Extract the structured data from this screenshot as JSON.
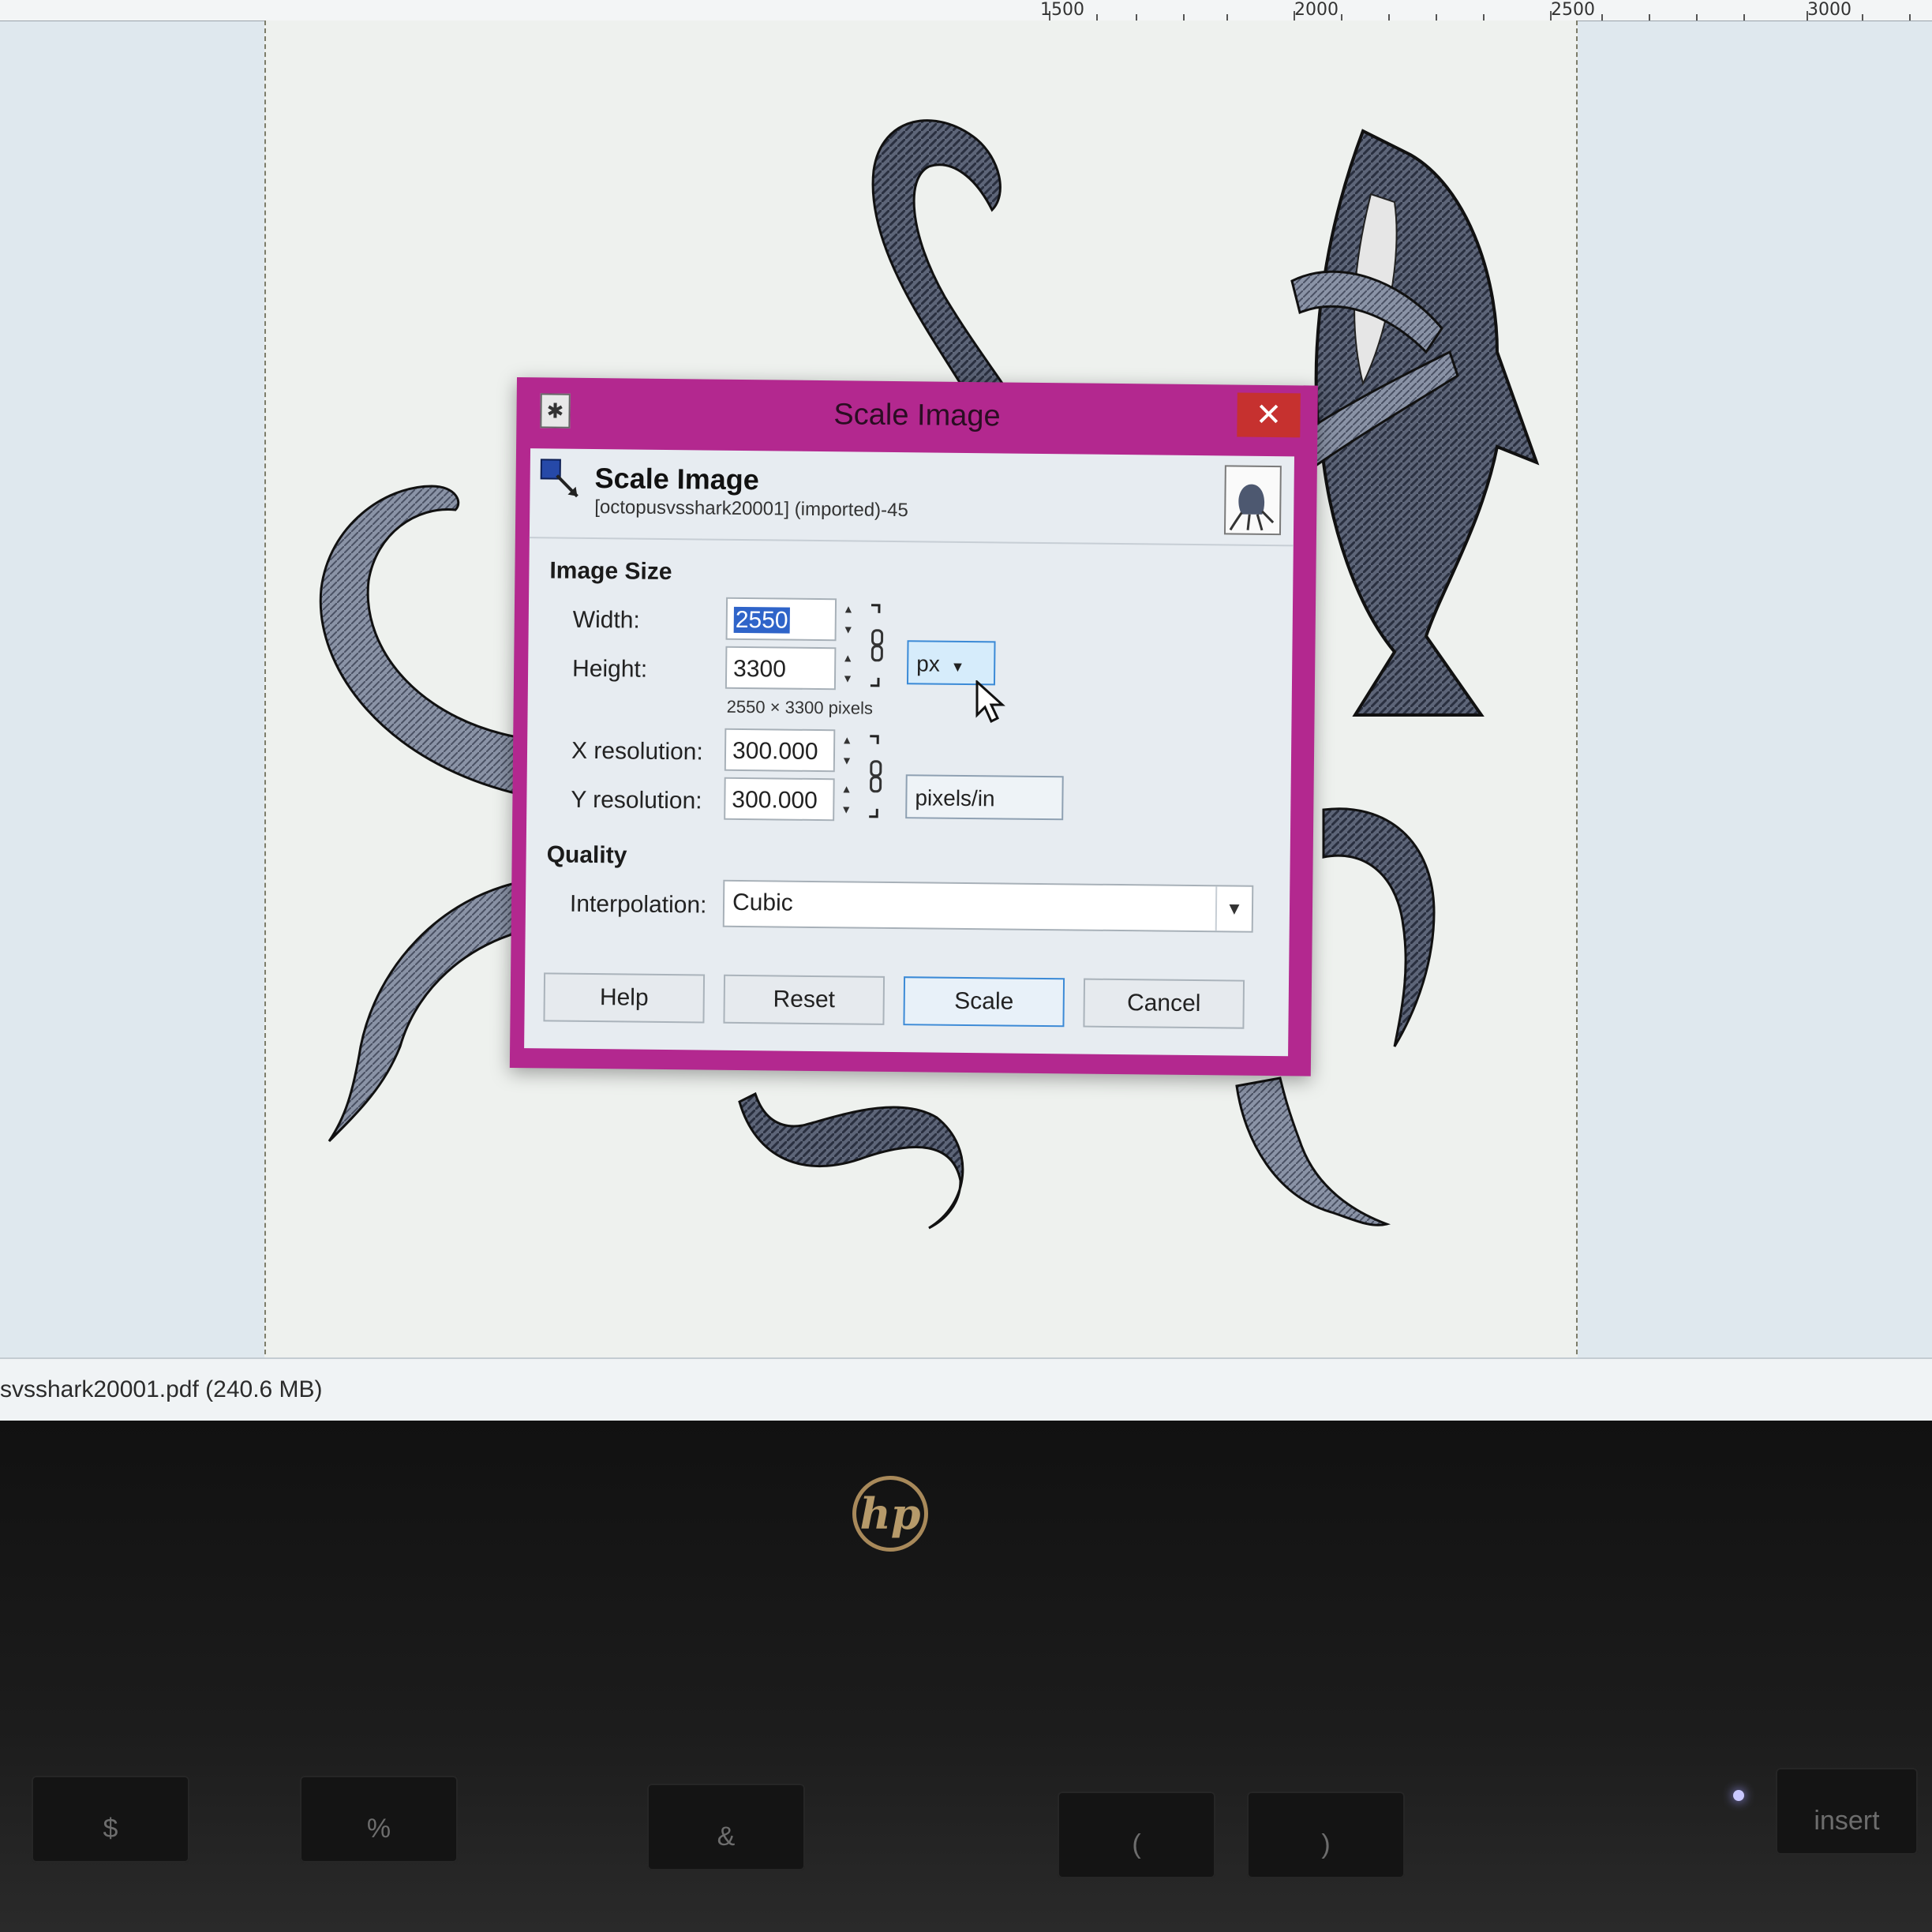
{
  "ruler": {
    "ticks": [
      "1500",
      "2000",
      "2500",
      "3000"
    ]
  },
  "status": {
    "file_text": "svsshark20001.pdf (240.6 MB)"
  },
  "dialog": {
    "window_title": "Scale Image",
    "close_glyph": "✕",
    "header_title": "Scale Image",
    "header_subtitle": "[octopusvsshark20001] (imported)-45",
    "image_size_section": "Image Size",
    "width_label": "Width:",
    "width_value": "2550",
    "height_label": "Height:",
    "height_value": "3300",
    "size_info": "2550 × 3300 pixels",
    "size_unit": "px",
    "x_res_label": "X resolution:",
    "x_res_value": "300.000",
    "y_res_label": "Y resolution:",
    "y_res_value": "300.000",
    "res_unit": "pixels/in",
    "quality_section": "Quality",
    "interpolation_label": "Interpolation:",
    "interpolation_value": "Cubic",
    "buttons": {
      "help": "Help",
      "reset": "Reset",
      "scale": "Scale",
      "cancel": "Cancel"
    }
  },
  "laptop": {
    "logo_text": "hp",
    "keys": [
      {
        "top": "",
        "main": "$"
      },
      {
        "top": "",
        "main": "%"
      },
      {
        "top": "",
        "main": "&"
      },
      {
        "top": "",
        "main": "("
      },
      {
        "top": "",
        "main": ")"
      },
      {
        "top": "",
        "main": "insert"
      }
    ]
  },
  "colors": {
    "dialog_frame": "#b3288f",
    "close_button": "#c6312f",
    "selection": "#2f64c9",
    "focus_border": "#3c8ad6"
  }
}
